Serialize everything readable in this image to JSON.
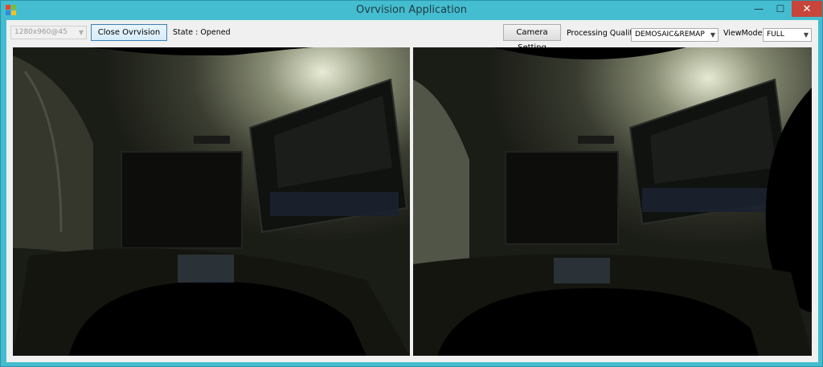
{
  "window": {
    "title": "Ovrvision Application",
    "minimize_glyph": "—",
    "maximize_glyph": "☐",
    "close_glyph": "✕"
  },
  "toolbar": {
    "resolution_value": "1280x960@45",
    "close_button_label": "Close Ovrvision",
    "state_text": "State : Opened",
    "camera_setting_label": "Camera Setting",
    "quality_label": "Processing Quality :",
    "quality_value": "DEMOSAIC&REMAP",
    "viewmode_label": "ViewMode :",
    "viewmode_value": "FULL"
  },
  "views": {
    "left_name": "left-camera-view",
    "right_name": "right-camera-view"
  },
  "icons": {
    "app": "app-icon",
    "dropdown": "chevron-down-icon"
  },
  "colors": {
    "titlebar": "#45bdd0",
    "close": "#c7453a",
    "client": "#f0f0f0",
    "viewport_bg": "#000000"
  }
}
